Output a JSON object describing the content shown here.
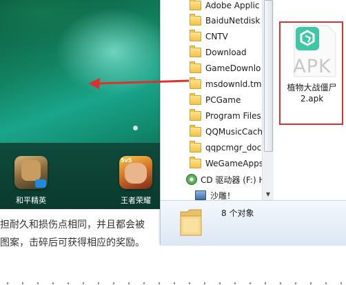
{
  "phone": {
    "apps": [
      {
        "label": "和平精英",
        "icon": "peace-elite-app-icon"
      },
      {
        "label": "王者荣耀",
        "icon": "honor-of-kings-app-icon",
        "tag": "5v5"
      }
    ]
  },
  "article": {
    "lines": [
      "担耐久和损伤点相同，并且都会被",
      "图案，击碎后可获得相应的奖励。"
    ]
  },
  "explorer": {
    "tree": [
      {
        "label": "Adobe Applic",
        "icon": "folder-icon"
      },
      {
        "label": "BaiduNetdisk",
        "icon": "folder-icon"
      },
      {
        "label": "CNTV",
        "icon": "folder-icon"
      },
      {
        "label": "Download",
        "icon": "folder-icon"
      },
      {
        "label": "GameDownlo",
        "icon": "folder-icon"
      },
      {
        "label": "msdownld.tm",
        "icon": "folder-icon"
      },
      {
        "label": "PCGame",
        "icon": "folder-icon"
      },
      {
        "label": "Program Files",
        "icon": "folder-icon"
      },
      {
        "label": "QQMusicCach",
        "icon": "folder-icon"
      },
      {
        "label": "qqpcmgr_doc",
        "icon": "folder-icon"
      },
      {
        "label": "WeGameApps",
        "icon": "folder-icon"
      },
      {
        "label": "CD 驱动器 (F:) H",
        "icon": "cd-drive-icon"
      },
      {
        "label": "沙雕！",
        "icon": "network-icon"
      }
    ],
    "file": {
      "icon_text": "APK",
      "name_line1": "植物大战僵尸",
      "name_line2": "2.apk"
    },
    "status": {
      "count_text": "8 个对象"
    }
  },
  "colors": {
    "highlight_border": "#d9322f",
    "arrow": "#e0302e",
    "apk_teal": "#3cc8a6"
  }
}
